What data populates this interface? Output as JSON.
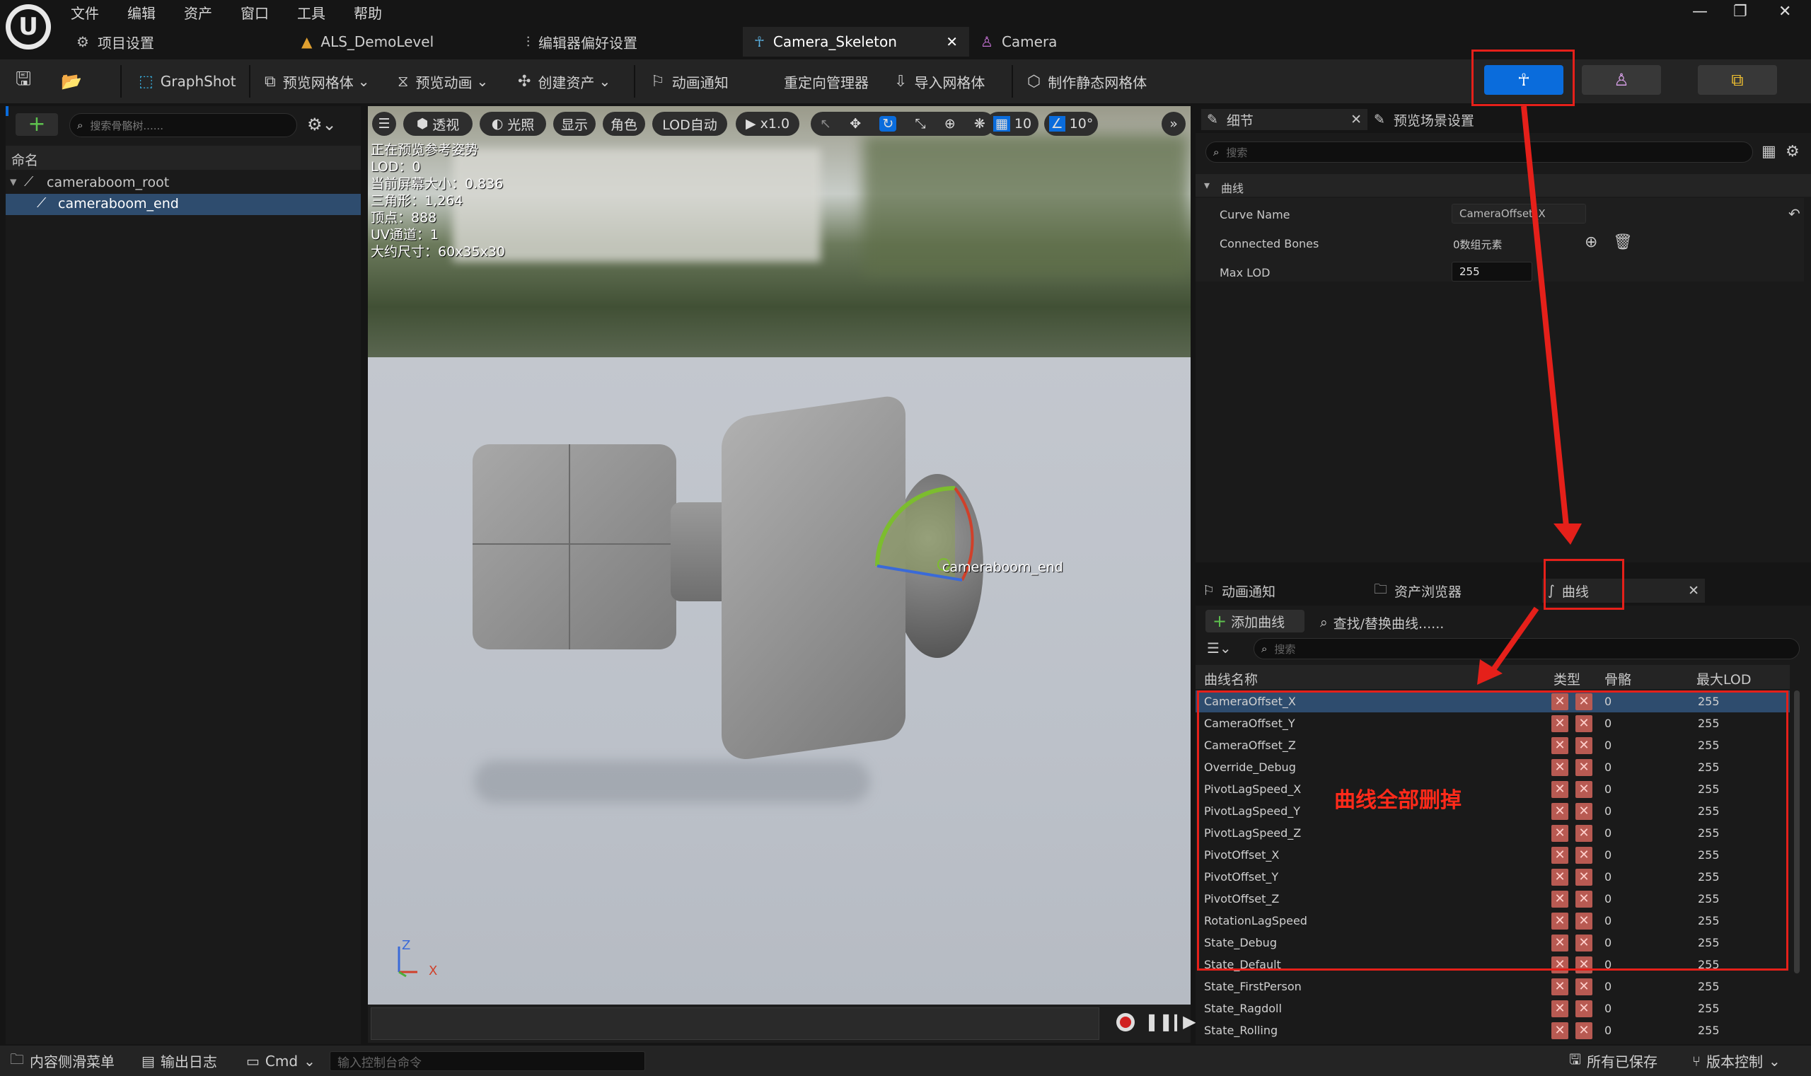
{
  "menu": [
    "文件",
    "编辑",
    "资产",
    "窗口",
    "工具",
    "帮助"
  ],
  "tabs": [
    {
      "label": "项目设置",
      "icon": "gear-icon"
    },
    {
      "label": "ALS_DemoLevel",
      "icon": "level-icon"
    },
    {
      "label": "编辑器偏好设置",
      "icon": "sliders-icon"
    },
    {
      "label": "Camera_Skeleton",
      "icon": "skeleton-icon"
    },
    {
      "label": "Camera",
      "icon": "skeletal-mesh-icon"
    }
  ],
  "tab_close": "✕",
  "toolbar": {
    "graphshot": "GraphShot",
    "preview_mesh": "预览网格体",
    "preview_anim": "预览动画",
    "create_asset": "创建资产",
    "anim_notify": "动画通知",
    "retarget": "重定向管理器",
    "import_mesh": "导入网格体",
    "make_static": "制作静态网格体"
  },
  "skeleton_tree": {
    "search_placeholder": "搜索骨骼树......",
    "column": "命名",
    "bones": [
      "cameraboom_root",
      "cameraboom_end"
    ]
  },
  "viewport": {
    "buttons": {
      "perspective": "透视",
      "lit": "光照",
      "show": "显示",
      "character": "角色",
      "lod": "LOD自动",
      "speed": "x1.0",
      "grid": "10",
      "angle": "10°"
    },
    "stats": [
      "正在预览参考姿势",
      "LOD：0",
      "当前屏幕大小：0.836",
      "三角形：1,264",
      "顶点：888",
      "UV通道：1",
      "大约尺寸：60x35x30"
    ],
    "bone_label": "cameraboom_end",
    "axis": {
      "z": "Z",
      "x": "X"
    }
  },
  "details": {
    "tab_details": "细节",
    "tab_scene": "预览场景设置",
    "search_placeholder": "搜索",
    "section": "曲线",
    "curve_name_label": "Curve Name",
    "curve_name_value": "CameraOffset_X",
    "connected_label": "Connected Bones",
    "connected_value": "0数组元素",
    "maxlod_label": "Max LOD",
    "maxlod_value": "255"
  },
  "curves_panel": {
    "tab_notify": "动画通知",
    "tab_assets": "资产浏览器",
    "tab_curves": "曲线",
    "add_curve": "添加曲线",
    "find_replace": "查找/替换曲线......",
    "search_placeholder": "搜索",
    "col_name": "曲线名称",
    "col_type": "类型",
    "col_bone": "骨骼",
    "col_lod": "最大LOD",
    "annotation": "曲线全部删掉",
    "rows": [
      {
        "name": "CameraOffset_X",
        "bone": "0",
        "lod": "255"
      },
      {
        "name": "CameraOffset_Y",
        "bone": "0",
        "lod": "255"
      },
      {
        "name": "CameraOffset_Z",
        "bone": "0",
        "lod": "255"
      },
      {
        "name": "Override_Debug",
        "bone": "0",
        "lod": "255"
      },
      {
        "name": "PivotLagSpeed_X",
        "bone": "0",
        "lod": "255"
      },
      {
        "name": "PivotLagSpeed_Y",
        "bone": "0",
        "lod": "255"
      },
      {
        "name": "PivotLagSpeed_Z",
        "bone": "0",
        "lod": "255"
      },
      {
        "name": "PivotOffset_X",
        "bone": "0",
        "lod": "255"
      },
      {
        "name": "PivotOffset_Y",
        "bone": "0",
        "lod": "255"
      },
      {
        "name": "PivotOffset_Z",
        "bone": "0",
        "lod": "255"
      },
      {
        "name": "RotationLagSpeed",
        "bone": "0",
        "lod": "255"
      },
      {
        "name": "State_Debug",
        "bone": "0",
        "lod": "255"
      },
      {
        "name": "State_Default",
        "bone": "0",
        "lod": "255"
      },
      {
        "name": "State_FirstPerson",
        "bone": "0",
        "lod": "255"
      },
      {
        "name": "State_Ragdoll",
        "bone": "0",
        "lod": "255"
      },
      {
        "name": "State_Rolling",
        "bone": "0",
        "lod": "255"
      }
    ]
  },
  "bottom": {
    "content_drawer": "内容侧滑菜单",
    "output_log": "输出日志",
    "cmd": "Cmd",
    "console_placeholder": "输入控制台命令",
    "saved": "所有已保存",
    "source_control": "版本控制"
  },
  "colors": {
    "accent_blue": "#0a6cdc",
    "highlight_red": "#e5201a",
    "selected_row": "#2e4c6e"
  }
}
